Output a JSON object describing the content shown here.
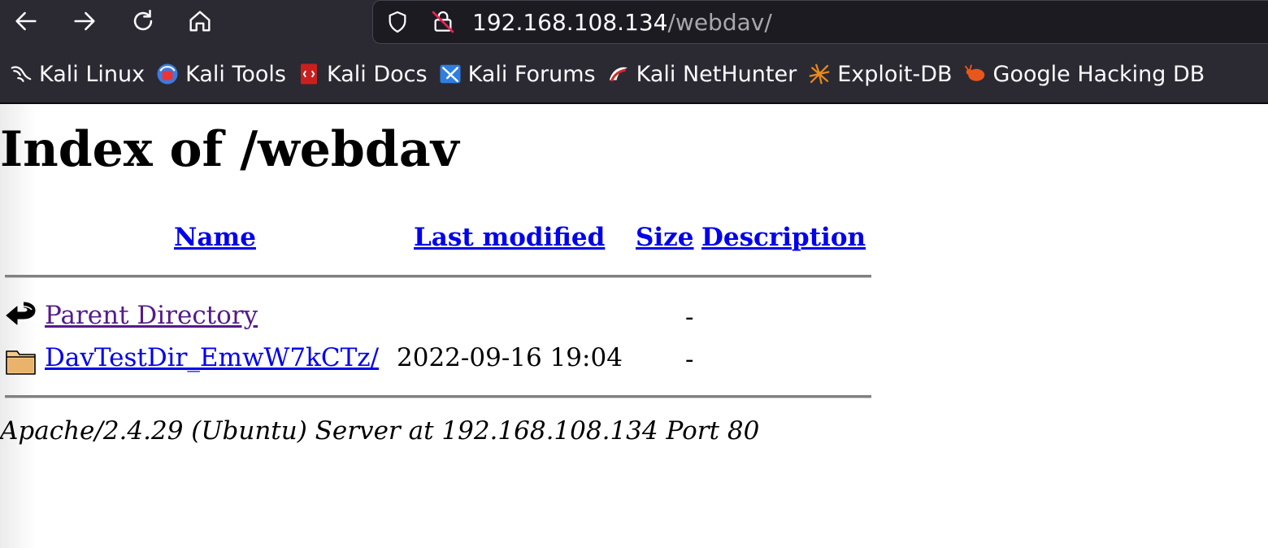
{
  "browser": {
    "url_host": "192.168.108.134",
    "url_path": "/webdav/",
    "bookmarks": [
      {
        "label": "Kali Linux",
        "icon": "kali-dragon-icon"
      },
      {
        "label": "Kali Tools",
        "icon": "kali-tools-icon"
      },
      {
        "label": "Kali Docs",
        "icon": "kali-docs-icon"
      },
      {
        "label": "Kali Forums",
        "icon": "kali-forums-icon"
      },
      {
        "label": "Kali NetHunter",
        "icon": "kali-nethunter-icon"
      },
      {
        "label": "Exploit-DB",
        "icon": "exploit-db-icon"
      },
      {
        "label": "Google Hacking DB",
        "icon": "ghdb-icon"
      }
    ]
  },
  "page": {
    "title": "Index of /webdav",
    "columns": {
      "name": "Name",
      "last_modified": "Last modified",
      "size": "Size",
      "description": "Description"
    },
    "rows": [
      {
        "name": "Parent Directory",
        "last_modified": "",
        "size": "-",
        "icon": "back-arrow-icon"
      },
      {
        "name": "DavTestDir_EmwW7kCTz/",
        "last_modified": "2022-09-16 19:04",
        "size": "-",
        "icon": "folder-icon"
      }
    ],
    "address": "Apache/2.4.29 (Ubuntu) Server at 192.168.108.134 Port 80"
  }
}
